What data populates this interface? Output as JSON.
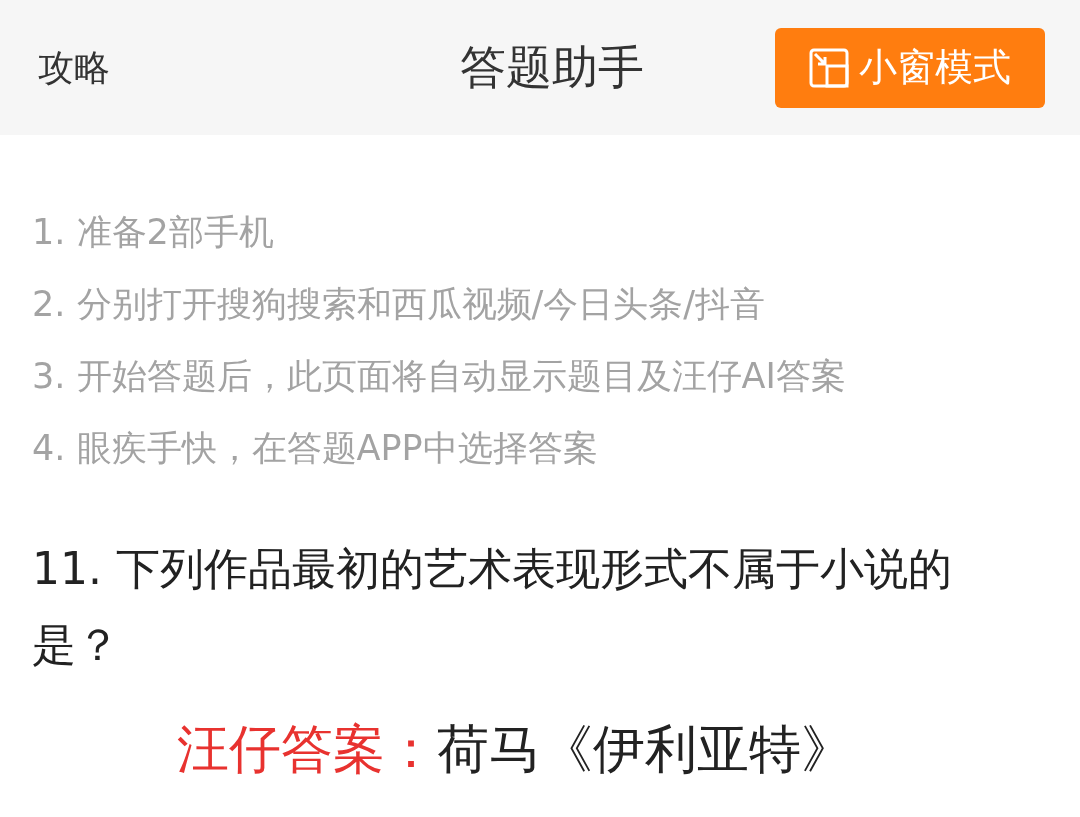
{
  "header": {
    "left_link": "攻略",
    "title": "答题助手",
    "mini_window_button": "小窗模式"
  },
  "steps": [
    "1. 准备2部手机",
    "2. 分别打开搜狗搜索和西瓜视频/今日头条/抖音",
    "3. 开始答题后，此页面将自动显示题目及汪仔AI答案",
    "4. 眼疾手快，在答题APP中选择答案"
  ],
  "question": "11. 下列作品最初的艺术表现形式不属于小说的是？",
  "answer": {
    "label": "汪仔答案：",
    "value": "荷马《伊利亚特》"
  }
}
